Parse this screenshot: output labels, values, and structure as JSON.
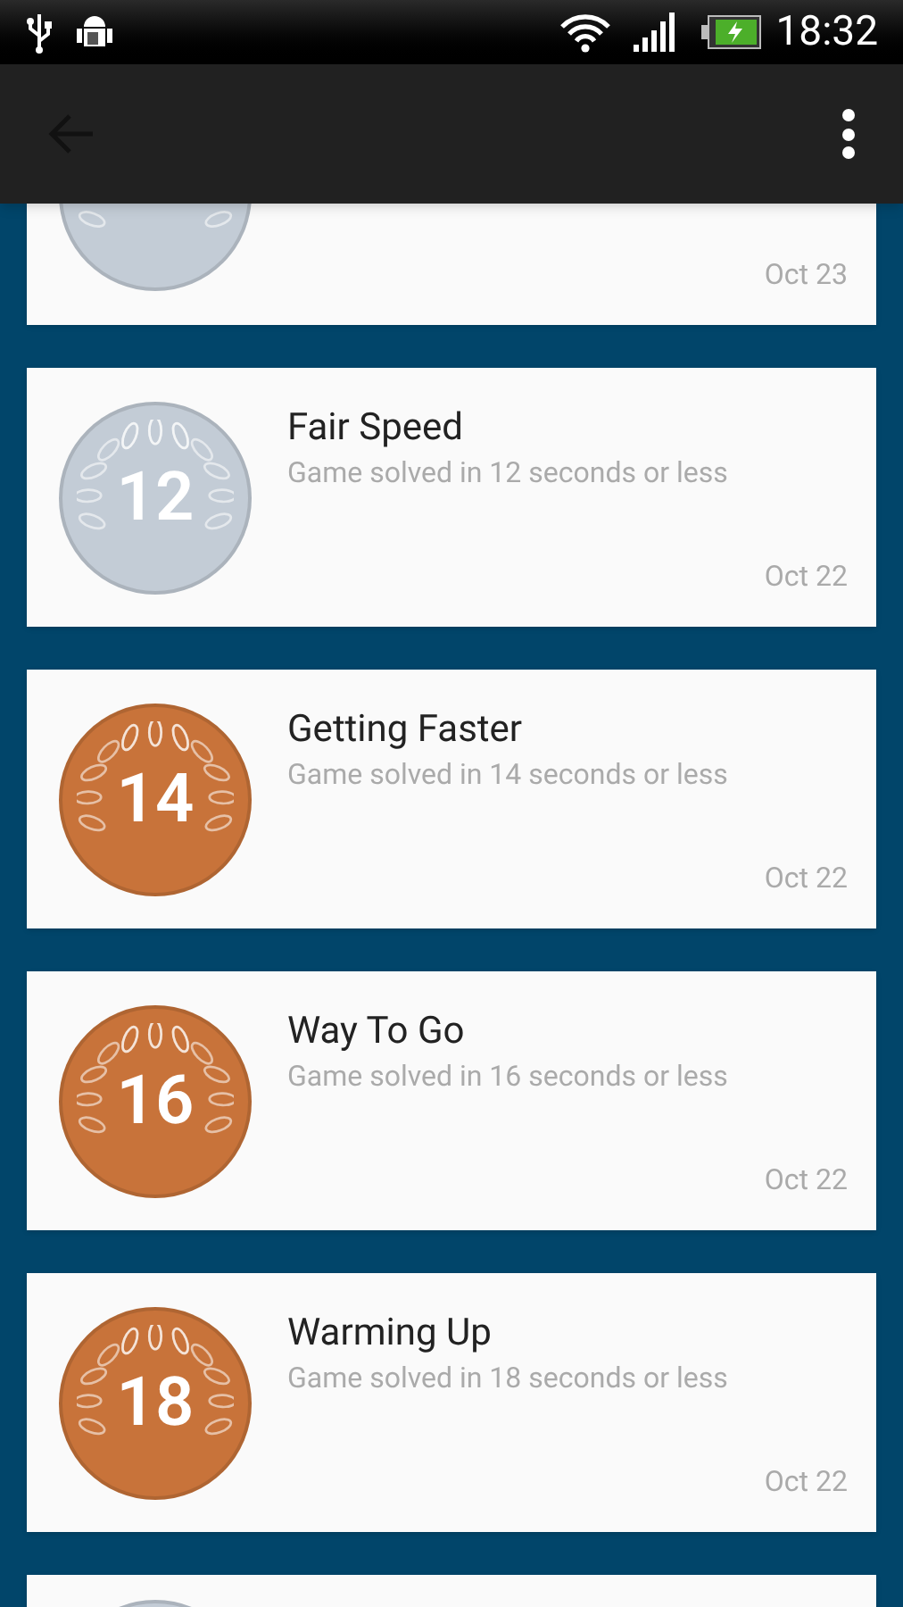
{
  "status_bar": {
    "time": "18:32"
  },
  "achievements": [
    {
      "color": "#c3ccd6",
      "date": "Oct 23"
    },
    {
      "color": "#c3ccd6",
      "number": "12",
      "title": "Fair Speed",
      "description": "Game solved in 12 seconds or less",
      "date": "Oct 22"
    },
    {
      "color": "#c8733a",
      "number": "14",
      "title": "Getting Faster",
      "description": "Game solved in 14 seconds or less",
      "date": "Oct 22"
    },
    {
      "color": "#c8733a",
      "number": "16",
      "title": "Way To Go",
      "description": "Game solved in 16 seconds or less",
      "date": "Oct 22"
    },
    {
      "color": "#c8733a",
      "number": "18",
      "title": "Warming Up",
      "description": "Game solved in 18 seconds or less",
      "date": "Oct 22"
    },
    {
      "color": "#c3ccd6"
    }
  ]
}
